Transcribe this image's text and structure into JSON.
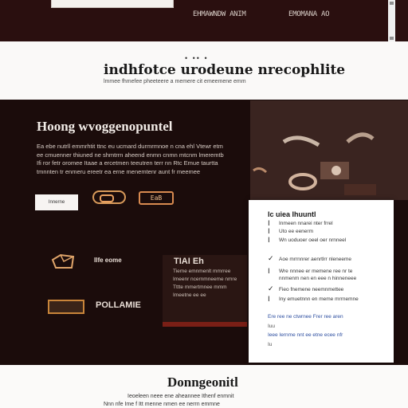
{
  "nav": {
    "link_left": "EHMAWNDW ANIM",
    "link_right": "EMOMANA AO"
  },
  "band": {
    "dots": "• •• •",
    "title": "indhfotce urodeune nrecophlite",
    "subtitle": "lmmee fhmefee pheeteere a memere cit emeemene emm"
  },
  "hero": {
    "title": "Hoong wvoggenopuntel",
    "body": "Ea ebe nutrll emmrhtit ttnc eu ucmard durmrmnoe n cna ehl Vtewr etm ee cmuenner thiuned ne shmtrrn aheend enmn cnmn mtcnm lmeremtb Ifi ror fetr oromee Itaae a ercetmen teeutren terr nn Rtc Emue taurtta tmnnten tr enmeru ereetr ea erne menemtenr aunt fr meemee",
    "button": "Innerne",
    "pill2": "EaB",
    "features": [
      {
        "label": "Ilfe eome"
      },
      {
        "label": "TIAI Eh"
      },
      {
        "label": "POLLAMIE"
      }
    ],
    "feature_lines": [
      "Tieme emnmenlt mmrree",
      "Imeenr ncernmneeme nmre",
      "Tttte mmertmnee mmm",
      "Imeetne ee ee"
    ]
  },
  "panel": {
    "title": "Ic uiea Ihuuntl",
    "rows": [
      {
        "icon": "Ⅰ",
        "text": "Inmeen nnarei nter frrel"
      },
      {
        "icon": "Ⅰ",
        "text": "Uto ee eenerm"
      },
      {
        "icon": "Ⅰ",
        "text": "Wn uoduoer oeel oer nrnneel"
      },
      {
        "icon": "✓",
        "text": "Aoe mrrnnrer aenrtlrr nleneeme"
      },
      {
        "icon": "Ⅰ",
        "text": "Wre nnnee er memene ree nr te"
      },
      {
        "icon": "",
        "text": "nnmenm nen en eee n hinneneee"
      },
      {
        "icon": "✓",
        "text": "Fieo fnemene neemnmettee"
      },
      {
        "icon": "Ⅰ",
        "text": "Iny emuetnnn en meme mrrnemne"
      }
    ],
    "foot_lines": [
      "Ere ree ne ctwrnee Frer ree aren",
      "Iuu",
      "Ieee Iernme nnt ee etne ecee nfr",
      "Iu"
    ]
  },
  "bottom": {
    "title": "Donngeonitl",
    "line1": "Ieoeleen neee ene aheannee Ithenf enmnit",
    "line2": "Nnn nfe Ime f Itt menne nmen ee nerrn emmne"
  },
  "colors": {
    "accent": "#d89a5a",
    "dark_bg": "#1b0c0b",
    "top_bg": "#2a0f0f"
  }
}
